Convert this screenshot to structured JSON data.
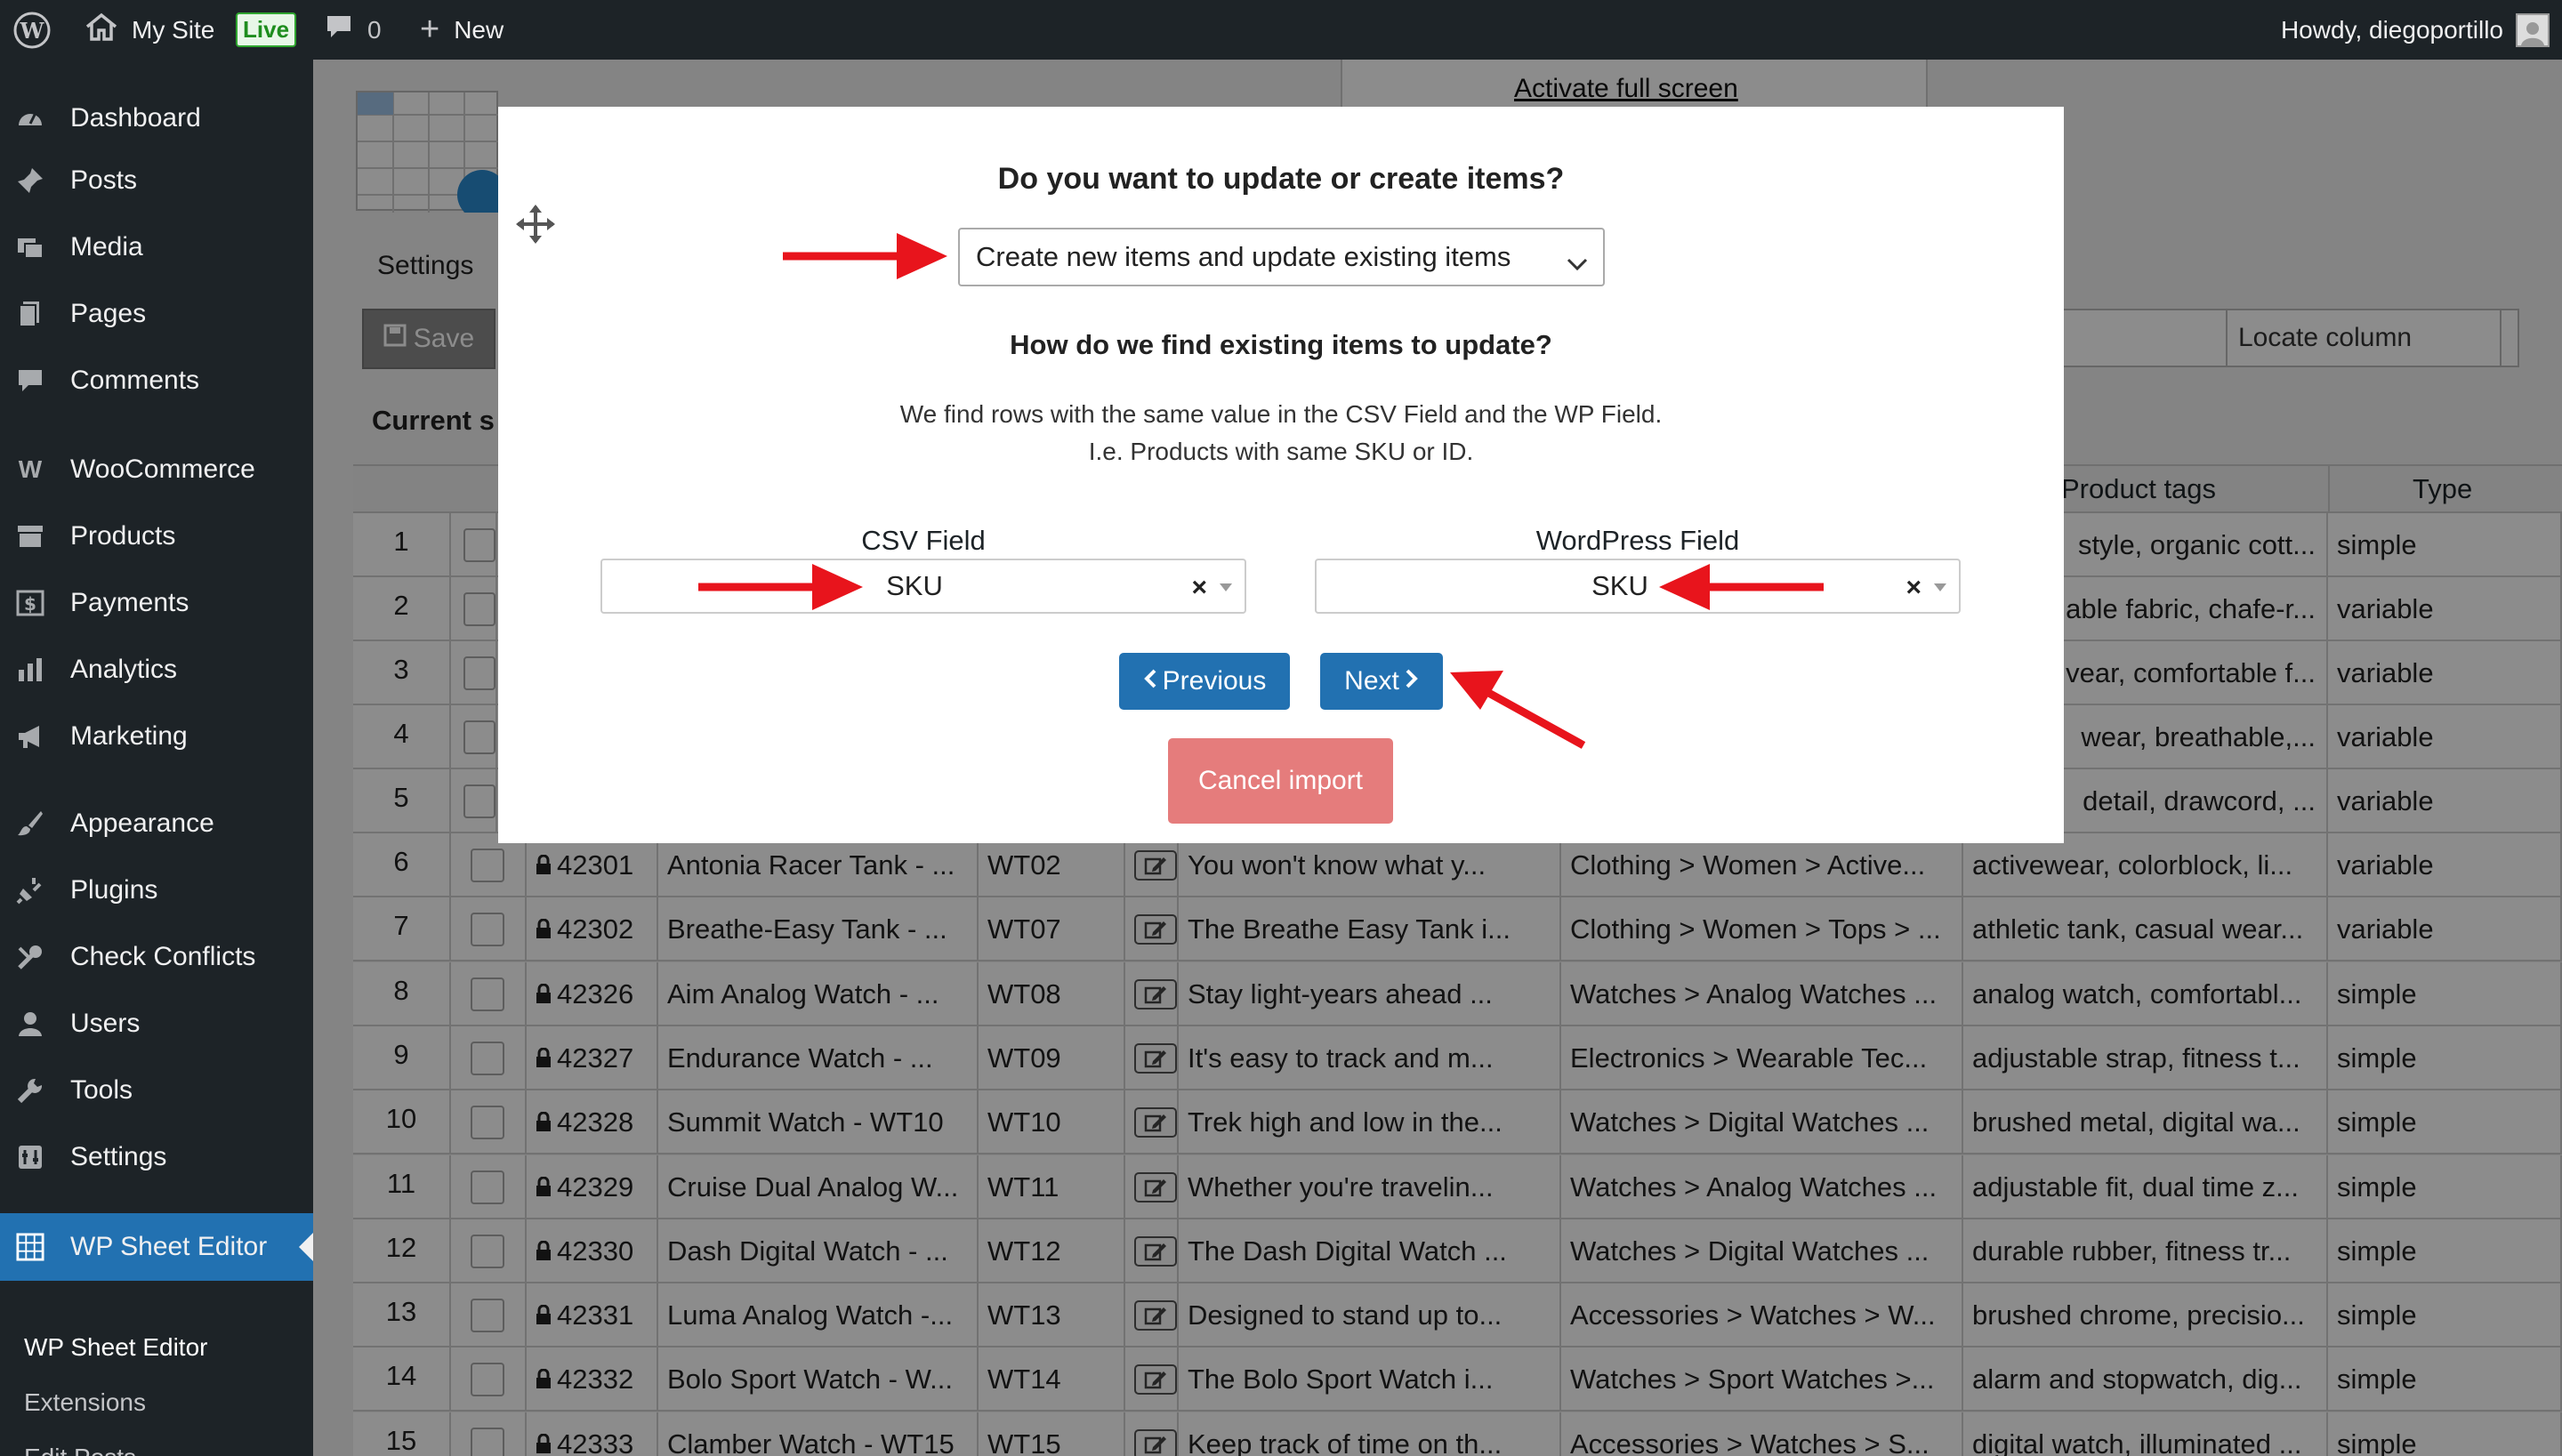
{
  "adminbar": {
    "site_name": "My Site",
    "live_badge": "Live",
    "comments_count": "0",
    "new_label": "New",
    "howdy": "Howdy, diegoportillo"
  },
  "sidebar": {
    "items": [
      {
        "label": "Dashboard",
        "icon": "dashboard-icon"
      },
      {
        "label": "Posts",
        "icon": "pin-icon"
      },
      {
        "label": "Media",
        "icon": "media-icon"
      },
      {
        "label": "Pages",
        "icon": "pages-icon"
      },
      {
        "label": "Comments",
        "icon": "comment-icon"
      },
      {
        "label": "WooCommerce",
        "icon": "woo-icon"
      },
      {
        "label": "Products",
        "icon": "archive-icon"
      },
      {
        "label": "Payments",
        "icon": "dollar-icon"
      },
      {
        "label": "Analytics",
        "icon": "bar-chart-icon"
      },
      {
        "label": "Marketing",
        "icon": "megaphone-icon"
      },
      {
        "label": "Appearance",
        "icon": "brush-icon"
      },
      {
        "label": "Plugins",
        "icon": "plug-icon"
      },
      {
        "label": "Check Conflicts",
        "icon": "tools-icon"
      },
      {
        "label": "Users",
        "icon": "user-icon"
      },
      {
        "label": "Tools",
        "icon": "wrench-icon"
      },
      {
        "label": "Settings",
        "icon": "settings-icon"
      },
      {
        "label": "WP Sheet Editor",
        "icon": "sheet-icon"
      }
    ],
    "submenu": [
      "WP Sheet Editor",
      "Extensions",
      "Edit Posts"
    ]
  },
  "toolbar": {
    "activate_full_screen": "Activate full screen",
    "settings_tab": "Settings",
    "save_label": "Save",
    "locate_column_placeholder": "Locate column",
    "current_label": "Current s"
  },
  "table": {
    "headers": {
      "product_tags": "Product tags",
      "type": "Type"
    },
    "top_rows": [
      {
        "num": "1",
        "tags": "style, organic cott...",
        "type": "simple"
      },
      {
        "num": "2",
        "tags": "able fabric, chafe-r...",
        "type": "variable"
      },
      {
        "num": "3",
        "tags": "vear, comfortable f...",
        "type": "variable"
      },
      {
        "num": "4",
        "tags": "wear, breathable,...",
        "type": "variable"
      },
      {
        "num": "5",
        "tags": "detail, drawcord, ...",
        "type": "variable"
      }
    ],
    "rows": [
      {
        "num": "6",
        "id": "42301",
        "title": "Antonia Racer Tank - ...",
        "sku": "WT02",
        "desc": "You won't know what y...",
        "cat": "Clothing > Women > Active...",
        "tags": "activewear, colorblock, li...",
        "type": "variable"
      },
      {
        "num": "7",
        "id": "42302",
        "title": "Breathe-Easy Tank - ...",
        "sku": "WT07",
        "desc": "The Breathe Easy Tank i...",
        "cat": "Clothing > Women > Tops > ...",
        "tags": "athletic tank, casual wear...",
        "type": "variable"
      },
      {
        "num": "8",
        "id": "42326",
        "title": "Aim Analog Watch - ...",
        "sku": "WT08",
        "desc": "Stay light-years ahead ...",
        "cat": "Watches > Analog Watches ...",
        "tags": "analog watch, comfortabl...",
        "type": "simple"
      },
      {
        "num": "9",
        "id": "42327",
        "title": "Endurance Watch - ...",
        "sku": "WT09",
        "desc": "It's easy to track and m...",
        "cat": "Electronics > Wearable Tec...",
        "tags": "adjustable strap, fitness t...",
        "type": "simple"
      },
      {
        "num": "10",
        "id": "42328",
        "title": "Summit Watch - WT10",
        "sku": "WT10",
        "desc": "Trek high and low in the...",
        "cat": "Watches > Digital Watches ...",
        "tags": "brushed metal, digital wa...",
        "type": "simple"
      },
      {
        "num": "11",
        "id": "42329",
        "title": "Cruise Dual Analog W...",
        "sku": "WT11",
        "desc": "Whether you're travelin...",
        "cat": "Watches > Analog Watches ...",
        "tags": "adjustable fit, dual time z...",
        "type": "simple"
      },
      {
        "num": "12",
        "id": "42330",
        "title": "Dash Digital Watch - ...",
        "sku": "WT12",
        "desc": "The Dash Digital Watch ...",
        "cat": "Watches > Digital Watches ...",
        "tags": "durable rubber, fitness tr...",
        "type": "simple"
      },
      {
        "num": "13",
        "id": "42331",
        "title": "Luma Analog Watch -...",
        "sku": "WT13",
        "desc": "Designed to stand up to...",
        "cat": "Accessories > Watches > W...",
        "tags": "brushed chrome, precisio...",
        "type": "simple"
      },
      {
        "num": "14",
        "id": "42332",
        "title": "Bolo Sport Watch - W...",
        "sku": "WT14",
        "desc": "The Bolo Sport Watch i...",
        "cat": "Watches > Sport Watches >...",
        "tags": "alarm and stopwatch, dig...",
        "type": "simple"
      },
      {
        "num": "15",
        "id": "42333",
        "title": "Clamber Watch - WT15",
        "sku": "WT15",
        "desc": "Keep track of time on th...",
        "cat": "Accessories > Watches > S...",
        "tags": "digital watch, illuminated ...",
        "type": "simple"
      }
    ]
  },
  "modal": {
    "question": "Do you want to update or create items?",
    "mode_value": "Create new items and update existing items",
    "find_title": "How do we find existing items to update?",
    "explain_line1": "We find rows with the same value in the CSV Field and the WP Field.",
    "explain_line2": "I.e. Products with same SKU or ID.",
    "csv_label": "CSV Field",
    "csv_value": "SKU",
    "wp_label": "WordPress Field",
    "wp_value": "SKU",
    "previous_label": "Previous",
    "next_label": "Next",
    "cancel_label": "Cancel import"
  },
  "colors": {
    "adminbar": "#1d2327",
    "accent": "#2271b1",
    "cancel": "#e57c7c",
    "arrow": "#e8141c"
  }
}
